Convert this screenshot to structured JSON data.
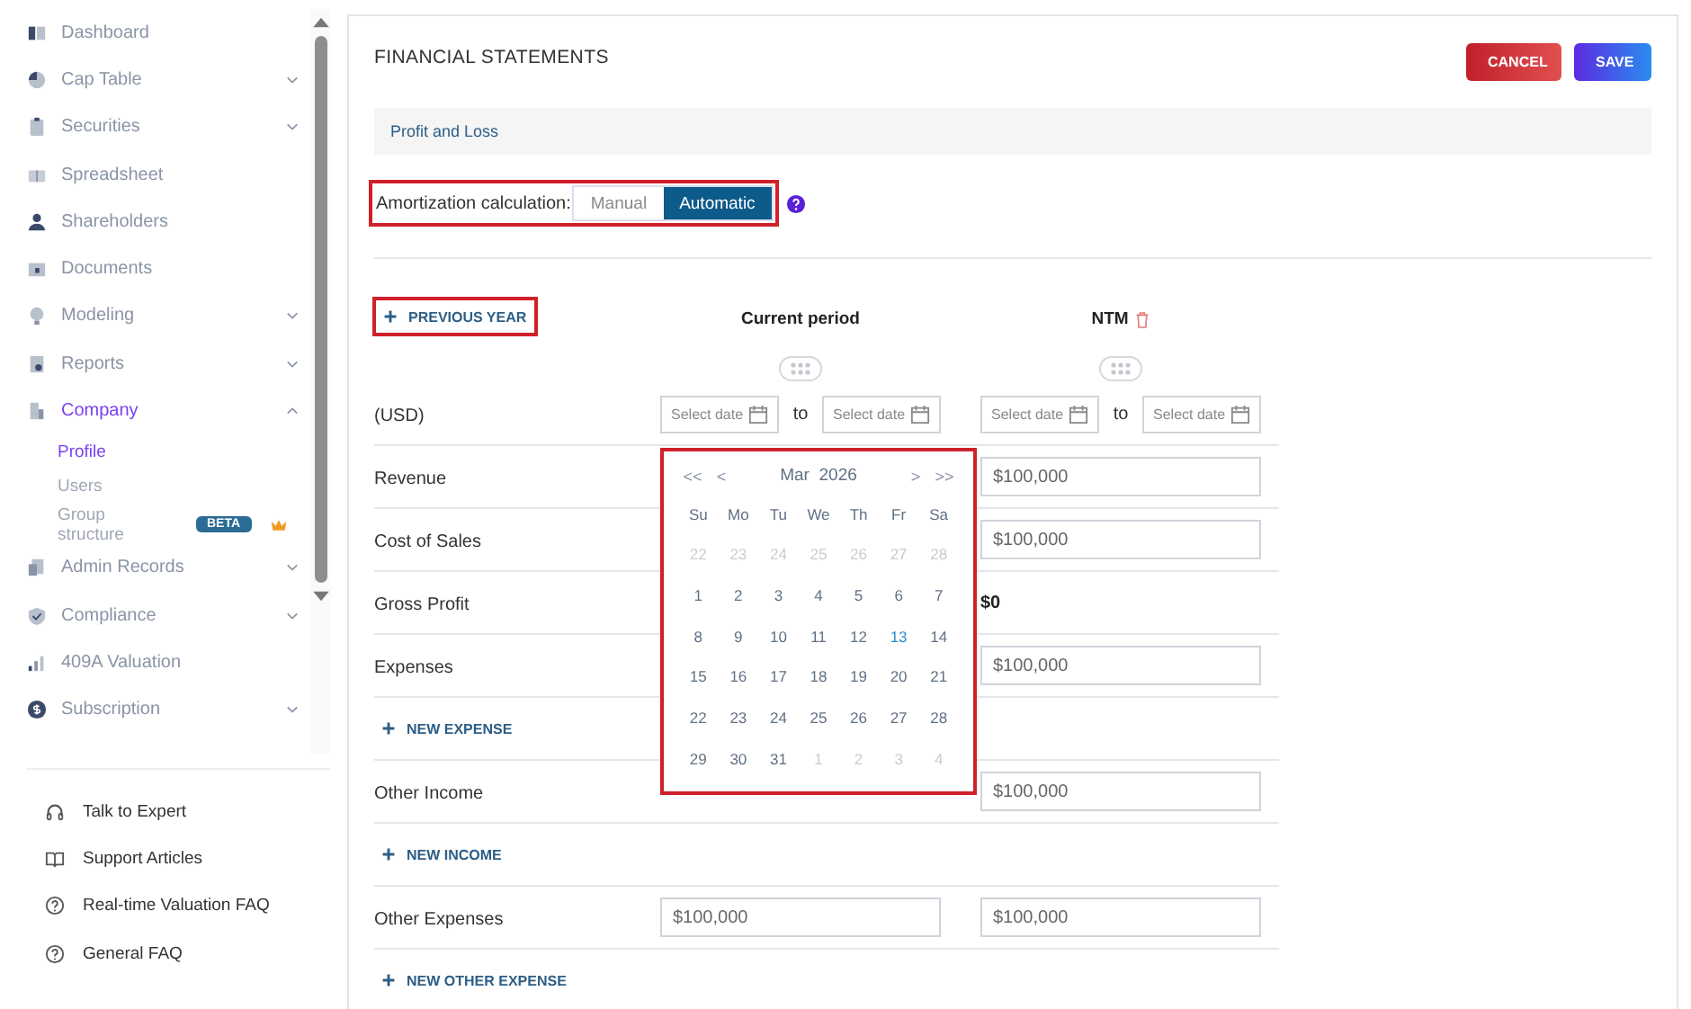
{
  "sidebar": {
    "items": [
      {
        "label": "Dashboard",
        "selected": false
      },
      {
        "label": "Cap Table",
        "selected": false,
        "expanded": false
      },
      {
        "label": "Securities",
        "selected": false,
        "expanded": false
      },
      {
        "label": "Spreadsheet",
        "selected": false
      },
      {
        "label": "Shareholders",
        "selected": false
      },
      {
        "label": "Documents",
        "selected": false
      },
      {
        "label": "Modeling",
        "selected": false,
        "expanded": false
      },
      {
        "label": "Reports",
        "selected": false,
        "expanded": false
      },
      {
        "label": "Company",
        "selected": true,
        "expanded": true,
        "children": [
          {
            "label": "Profile",
            "selected": true
          },
          {
            "label": "Users",
            "selected": false
          },
          {
            "label": "Group structure",
            "selected": false,
            "badge": "BETA",
            "premium": true
          }
        ]
      },
      {
        "label": "Admin Records",
        "selected": false,
        "expanded": false
      },
      {
        "label": "Compliance",
        "selected": false,
        "expanded": false
      },
      {
        "label": "409A Valuation",
        "selected": false
      },
      {
        "label": "Subscription",
        "selected": false,
        "expanded": false
      }
    ],
    "footer": [
      "Talk to Expert",
      "Support Articles",
      "Real-time Valuation FAQ",
      "General FAQ"
    ]
  },
  "page": {
    "title": "FINANCIAL STATEMENTS",
    "buttons": [
      {
        "label": "CANCEL",
        "kind": "cancel"
      },
      {
        "label": "SAVE",
        "kind": "save"
      }
    ],
    "section": "Profit and Loss",
    "amortization": {
      "label": "Amortization calculation:",
      "options": [
        {
          "label": "Manual",
          "selected": false
        },
        {
          "label": "Automatic",
          "selected": true
        }
      ]
    },
    "previous_year": "PREVIOUS YEAR",
    "periods": [
      {
        "title": "Current period",
        "deletable": false,
        "from_placeholder": "Select date",
        "to": "to",
        "until_placeholder": "Select date"
      },
      {
        "title": "NTM",
        "deletable": true,
        "from_placeholder": "Select date",
        "to": "to",
        "until_placeholder": "Select date"
      }
    ],
    "currency": "(USD)",
    "rows": [
      {
        "kind": "input",
        "label": "Revenue",
        "ntm": "$100,000"
      },
      {
        "kind": "input",
        "label": "Cost of Sales",
        "ntm": "$100,000"
      },
      {
        "kind": "total",
        "label": "Gross Profit",
        "ntm": "$0"
      },
      {
        "kind": "input",
        "label": "Expenses",
        "ntm": "$100,000"
      },
      {
        "kind": "add",
        "label": "NEW EXPENSE"
      },
      {
        "kind": "input",
        "label": "Other Income",
        "ntm": "$100,000"
      },
      {
        "kind": "add",
        "label": "NEW INCOME"
      },
      {
        "kind": "input",
        "label": "Other Expenses",
        "current": "$100,000",
        "ntm": "$100,000"
      },
      {
        "kind": "add",
        "label": "NEW OTHER EXPENSE"
      }
    ],
    "calendar": {
      "month": "Mar",
      "year": "2026",
      "nav": [
        "<<",
        "<",
        ">",
        ">>"
      ],
      "weekdays": [
        "Su",
        "Mo",
        "Tu",
        "We",
        "Th",
        "Fr",
        "Sa"
      ],
      "weeks": [
        [
          {
            "d": "22",
            "muted": true
          },
          {
            "d": "23",
            "muted": true
          },
          {
            "d": "24",
            "muted": true
          },
          {
            "d": "25",
            "muted": true
          },
          {
            "d": "26",
            "muted": true
          },
          {
            "d": "27",
            "muted": true
          },
          {
            "d": "28",
            "muted": true
          }
        ],
        [
          {
            "d": "1",
            "muted": false
          },
          {
            "d": "2",
            "muted": false
          },
          {
            "d": "3",
            "muted": false
          },
          {
            "d": "4",
            "muted": false
          },
          {
            "d": "5",
            "muted": false
          },
          {
            "d": "6",
            "muted": false
          },
          {
            "d": "7",
            "muted": false
          }
        ],
        [
          {
            "d": "8",
            "muted": false
          },
          {
            "d": "9",
            "muted": false
          },
          {
            "d": "10",
            "muted": false
          },
          {
            "d": "11",
            "muted": false
          },
          {
            "d": "12",
            "muted": false
          },
          {
            "d": "13",
            "muted": false,
            "today": true
          },
          {
            "d": "14",
            "muted": false
          }
        ],
        [
          {
            "d": "15",
            "muted": false
          },
          {
            "d": "16",
            "muted": false
          },
          {
            "d": "17",
            "muted": false
          },
          {
            "d": "18",
            "muted": false
          },
          {
            "d": "19",
            "muted": false
          },
          {
            "d": "20",
            "muted": false
          },
          {
            "d": "21",
            "muted": false
          }
        ],
        [
          {
            "d": "22",
            "muted": false
          },
          {
            "d": "23",
            "muted": false
          },
          {
            "d": "24",
            "muted": false
          },
          {
            "d": "25",
            "muted": false
          },
          {
            "d": "26",
            "muted": false
          },
          {
            "d": "27",
            "muted": false
          },
          {
            "d": "28",
            "muted": false
          }
        ],
        [
          {
            "d": "29",
            "muted": false
          },
          {
            "d": "30",
            "muted": false
          },
          {
            "d": "31",
            "muted": false
          },
          {
            "d": "1",
            "muted": true
          },
          {
            "d": "2",
            "muted": true
          },
          {
            "d": "3",
            "muted": true
          },
          {
            "d": "4",
            "muted": true
          }
        ]
      ]
    }
  }
}
